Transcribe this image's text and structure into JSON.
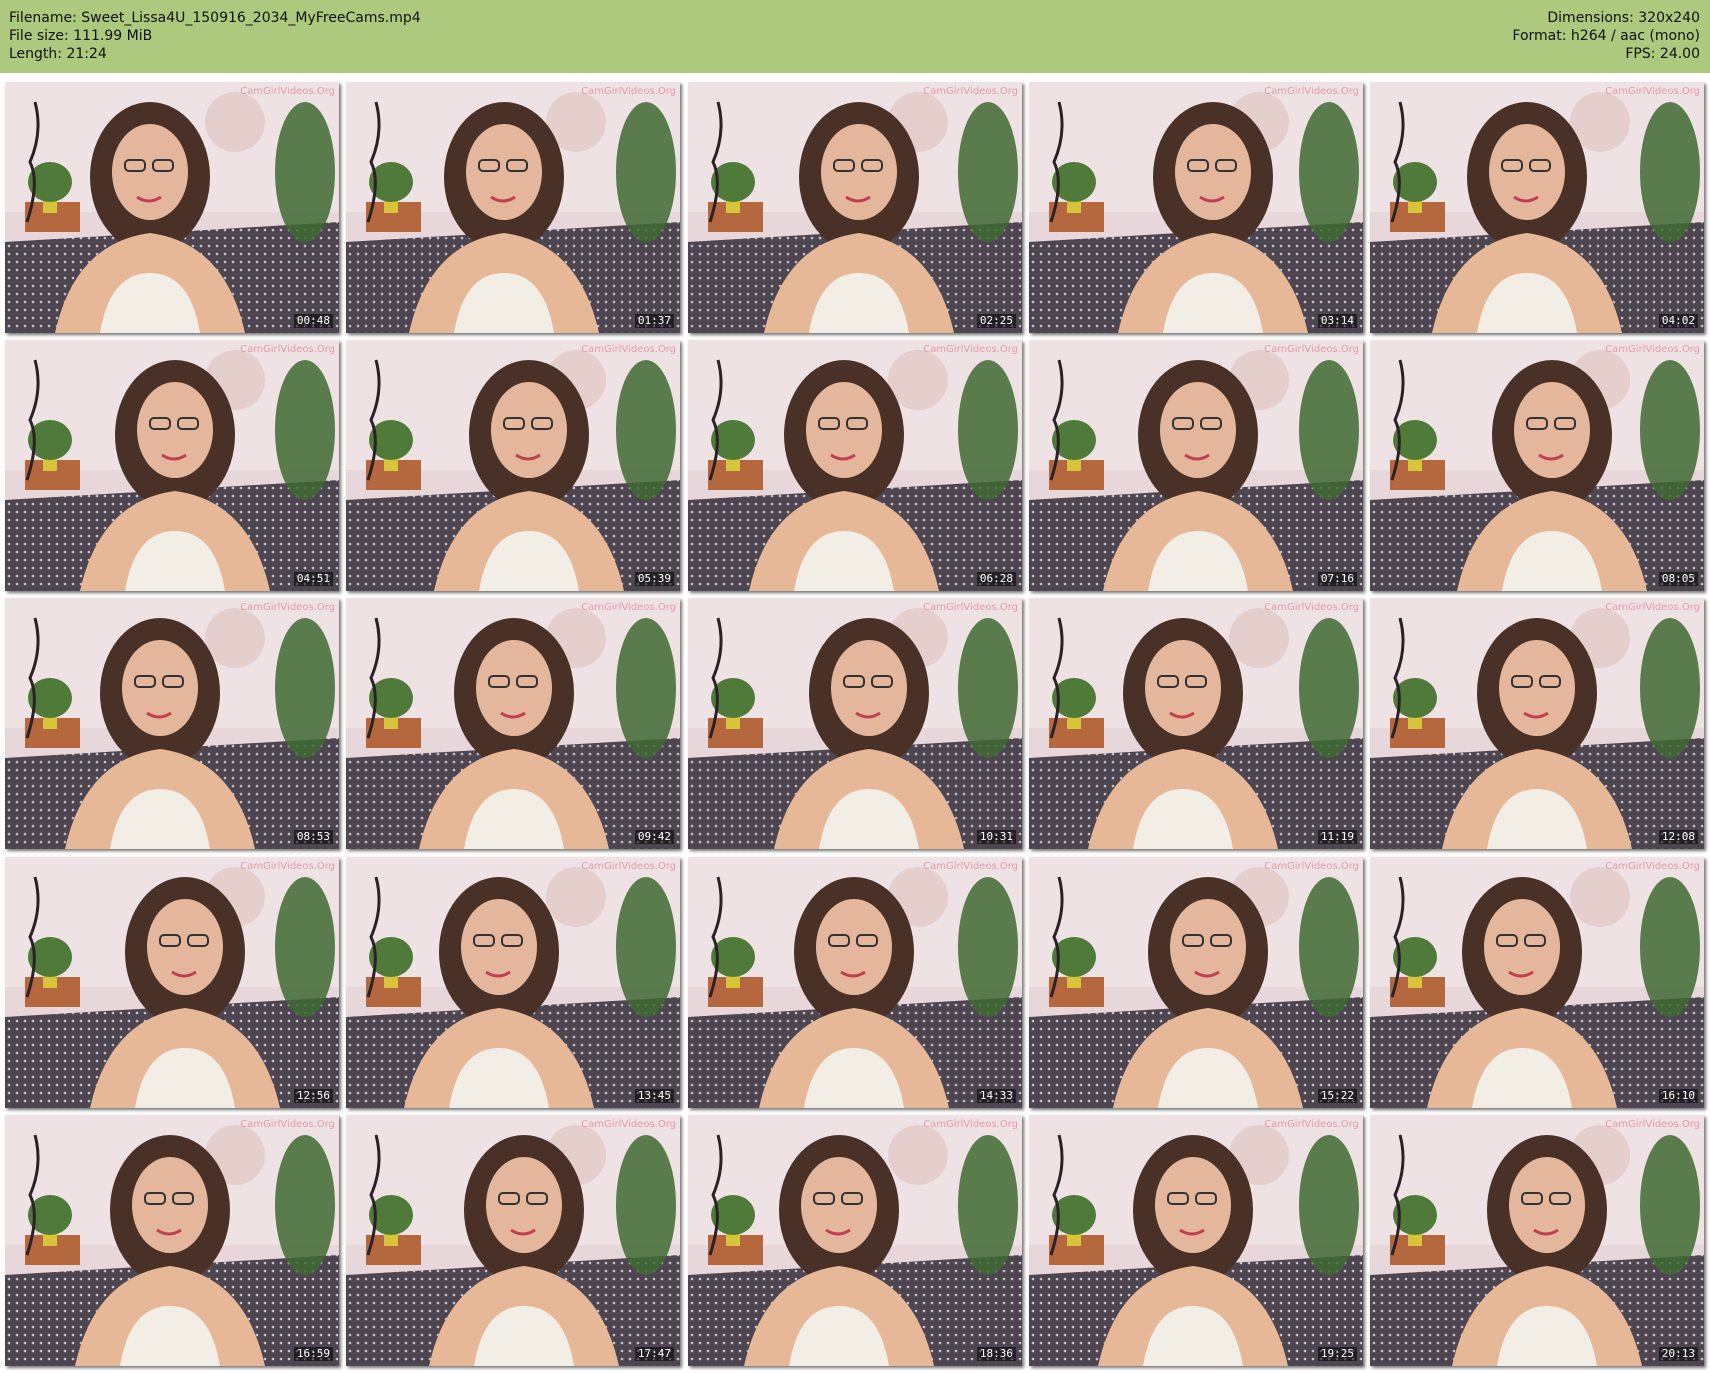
{
  "header": {
    "filename_label": "Filename: Sweet_Lissa4U_150916_2034_MyFreeCams.mp4",
    "filesize_label": "File size: 111.99 MiB",
    "length_label": "Length: 21:24",
    "dimensions_label": "Dimensions: 320x240",
    "format_label": "Format: h264 / aac (mono)",
    "fps_label": "FPS: 24.00"
  },
  "watermark": "CamGirlVideos.Org",
  "thumbnails": [
    {
      "time": "00:48"
    },
    {
      "time": "01:37"
    },
    {
      "time": "02:25"
    },
    {
      "time": "03:14"
    },
    {
      "time": "04:02"
    },
    {
      "time": "04:51"
    },
    {
      "time": "05:39"
    },
    {
      "time": "06:28"
    },
    {
      "time": "07:16"
    },
    {
      "time": "08:05"
    },
    {
      "time": "08:53"
    },
    {
      "time": "09:42"
    },
    {
      "time": "10:31"
    },
    {
      "time": "11:19"
    },
    {
      "time": "12:08"
    },
    {
      "time": "12:56"
    },
    {
      "time": "13:45"
    },
    {
      "time": "14:33"
    },
    {
      "time": "15:22"
    },
    {
      "time": "16:10"
    },
    {
      "time": "16:59"
    },
    {
      "time": "17:47"
    },
    {
      "time": "18:36"
    },
    {
      "time": "19:25"
    },
    {
      "time": "20:13"
    }
  ]
}
